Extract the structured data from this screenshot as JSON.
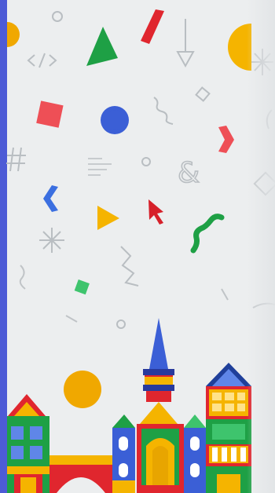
{
  "scene": {
    "background_color": "#eceeef",
    "edge_bar_color": "#4d5bd6",
    "palette": {
      "red": "#e8343a",
      "yellow": "#f5b400",
      "green": "#1ea045",
      "blue": "#3b5fd6",
      "outline": "#b9bec2"
    }
  },
  "illustration": {
    "floating_icons": [
      "half-circle-icon",
      "code-brackets-icon",
      "triangle-icon",
      "slash-icon",
      "down-arrow-icon",
      "square-icon",
      "circle-icon",
      "squiggle-icon",
      "chevron-right-icon",
      "hash-icon",
      "text-lines-icon",
      "ampersand-icon",
      "chevron-left-icon",
      "play-triangle-icon",
      "cursor-arrow-icon",
      "asterisk-icon",
      "worm-icon",
      "diamond-icon",
      "zigzag-icon",
      "sun-icon"
    ],
    "buildings": [
      "left-house",
      "bridge",
      "tower-castle",
      "right-house"
    ]
  }
}
